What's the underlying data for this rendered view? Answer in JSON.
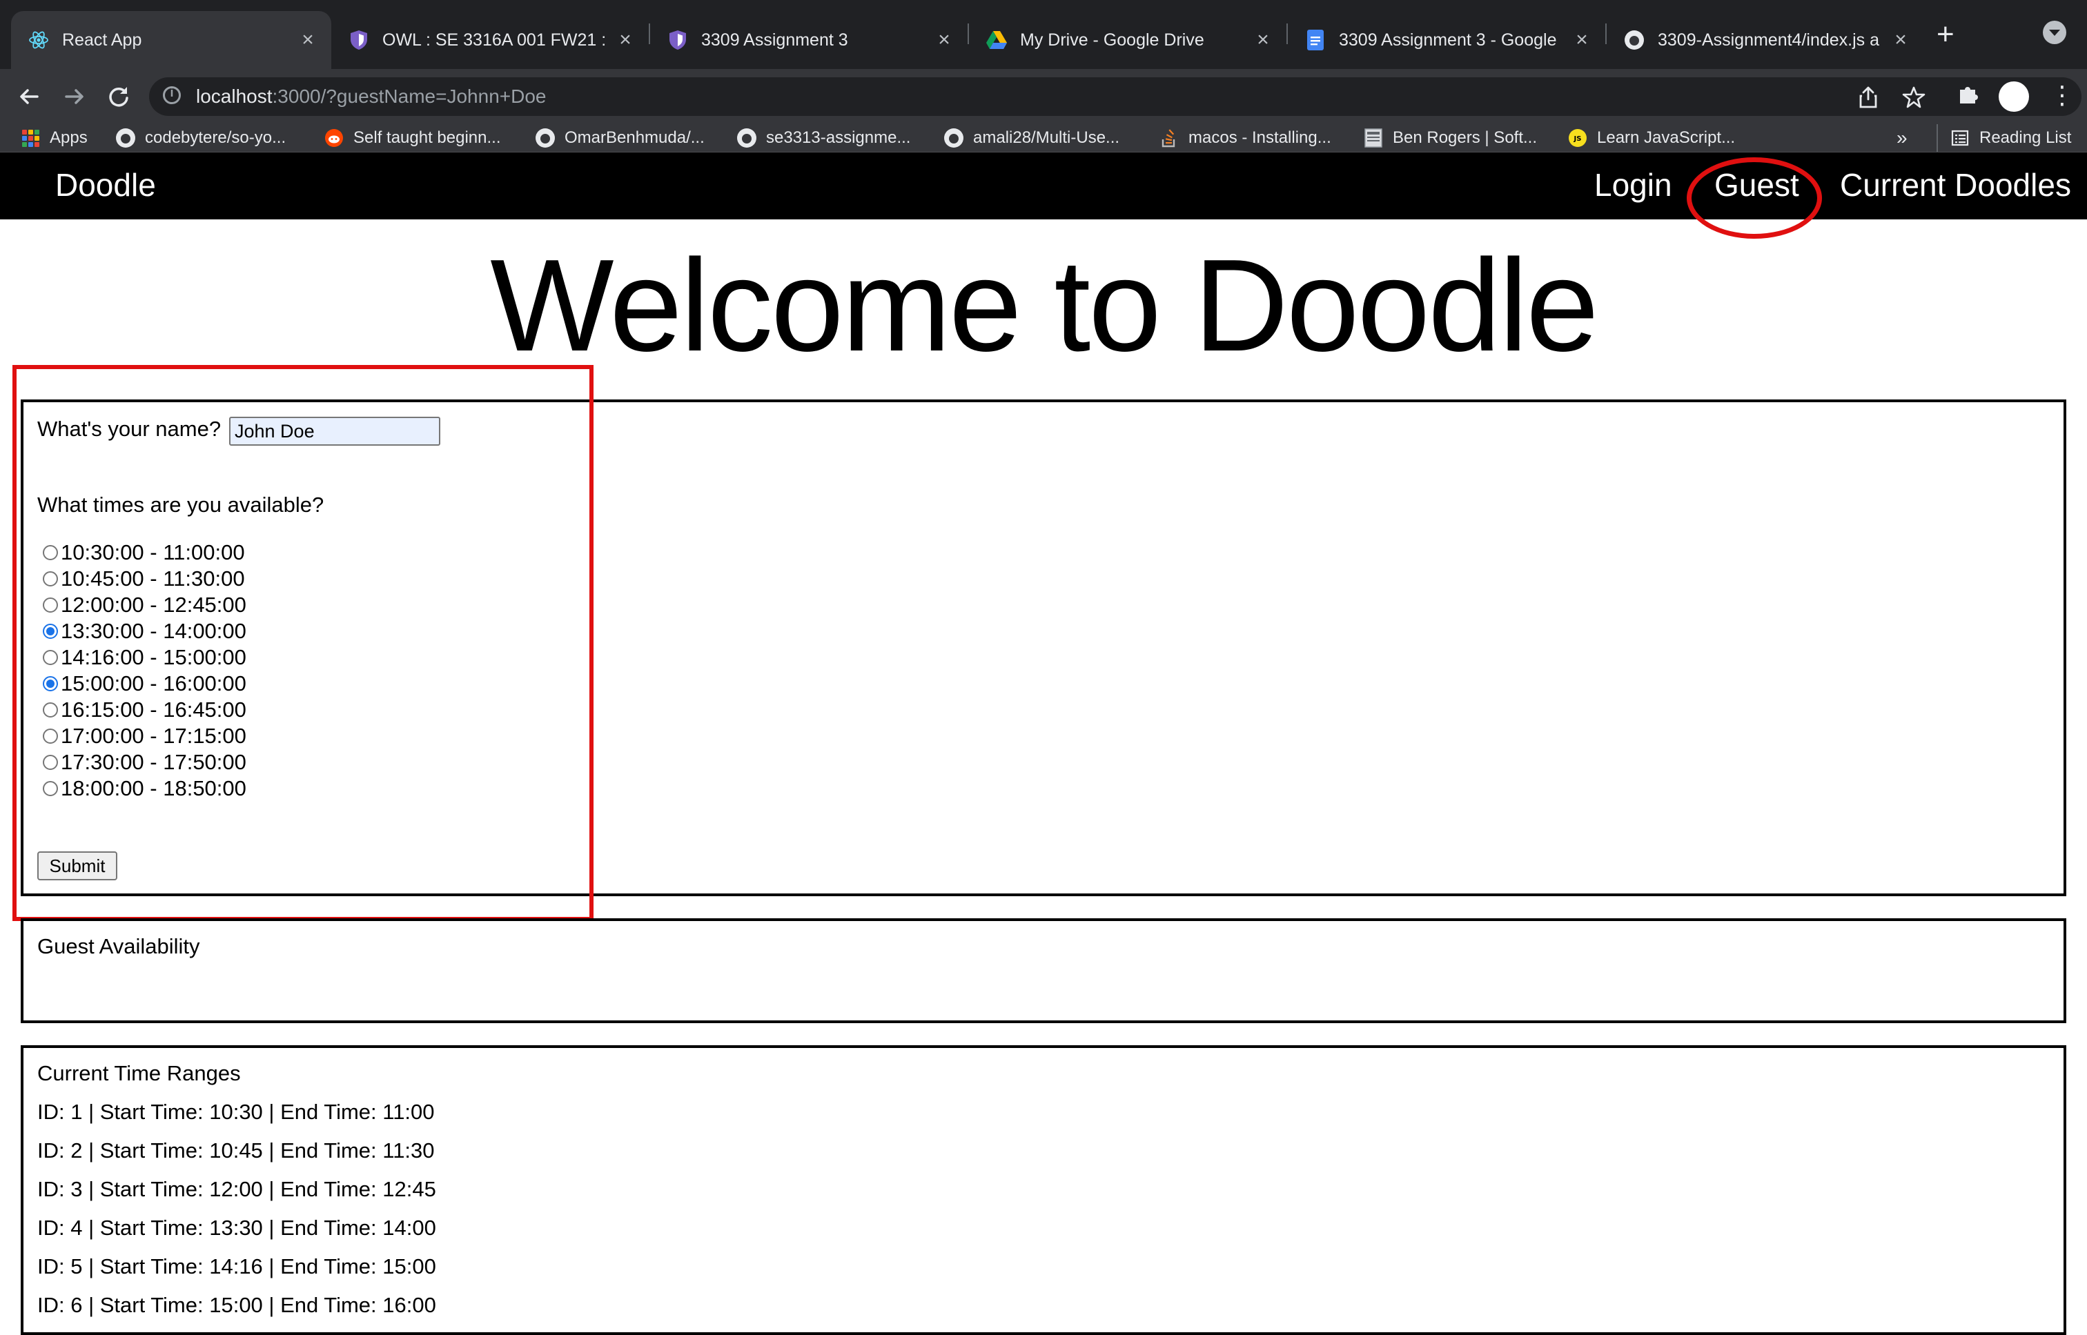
{
  "browser": {
    "tabs": [
      {
        "title": "React App",
        "favicon": "react-icon",
        "active": true
      },
      {
        "title": "OWL : SE 3316A 001 FW21 : A",
        "favicon": "shield-icon",
        "active": false
      },
      {
        "title": "3309 Assignment 3",
        "favicon": "shield-icon",
        "active": false
      },
      {
        "title": "My Drive - Google Drive",
        "favicon": "google-drive-icon",
        "active": false
      },
      {
        "title": "3309 Assignment 3 - Google",
        "favicon": "google-docs-icon",
        "active": false
      },
      {
        "title": "3309-Assignment4/index.js a",
        "favicon": "github-icon",
        "active": false
      }
    ],
    "tab_close_glyph": "×",
    "new_tab_glyph": "+",
    "url_host": "localhost",
    "url_rest": ":3000/?guestName=Johnn+Doe",
    "bookmarks": [
      {
        "label": "Apps",
        "icon": "apps-grid-icon"
      },
      {
        "label": "codebytere/so-yo...",
        "icon": "github-icon"
      },
      {
        "label": "Self taught beginn...",
        "icon": "reddit-icon"
      },
      {
        "label": "OmarBenhmuda/...",
        "icon": "github-icon"
      },
      {
        "label": "se3313-assignme...",
        "icon": "github-icon"
      },
      {
        "label": "amali28/Multi-Use...",
        "icon": "github-icon"
      },
      {
        "label": "macos - Installing...",
        "icon": "stackoverflow-icon"
      },
      {
        "label": "Ben Rogers | Soft...",
        "icon": "page-icon"
      },
      {
        "label": "Learn JavaScript...",
        "icon": "js-icon"
      }
    ],
    "bookmarks_overflow": "»",
    "reading_list": "Reading List"
  },
  "app": {
    "brand": "Doodle",
    "nav": {
      "login": "Login",
      "guest": "Guest",
      "current": "Current Doodles"
    },
    "hero_title": "Welcome to Doodle",
    "form": {
      "name_label": "What's your name?",
      "name_value": "John Doe",
      "times_label": "What times are you available?",
      "options": [
        {
          "label": "10:30:00 - 11:00:00",
          "checked": false
        },
        {
          "label": "10:45:00 - 11:30:00",
          "checked": false
        },
        {
          "label": "12:00:00 - 12:45:00",
          "checked": false
        },
        {
          "label": "13:30:00 - 14:00:00",
          "checked": true
        },
        {
          "label": "14:16:00 - 15:00:00",
          "checked": false
        },
        {
          "label": "15:00:00 - 16:00:00",
          "checked": true
        },
        {
          "label": "16:15:00 - 16:45:00",
          "checked": false
        },
        {
          "label": "17:00:00 - 17:15:00",
          "checked": false
        },
        {
          "label": "17:30:00 - 17:50:00",
          "checked": false
        },
        {
          "label": "18:00:00 - 18:50:00",
          "checked": false
        }
      ],
      "submit": "Submit"
    },
    "guest_availability": {
      "title": "Guest Availability"
    },
    "time_ranges": {
      "title": "Current Time Ranges",
      "rows": [
        "ID: 1 | Start Time: 10:30 | End Time: 11:00",
        "ID: 2 | Start Time: 10:45 | End Time: 11:30",
        "ID: 3 | Start Time: 12:00 | End Time: 12:45",
        "ID: 4 | Start Time: 13:30 | End Time: 14:00",
        "ID: 5 | Start Time: 14:16 | End Time: 15:00",
        "ID: 6 | Start Time: 15:00 | End Time: 16:00"
      ]
    }
  },
  "colors": {
    "annotation_red": "#e01010",
    "radio_blue": "#1a73e8",
    "navbar_bg": "#000000",
    "chrome_dark": "#202124"
  }
}
